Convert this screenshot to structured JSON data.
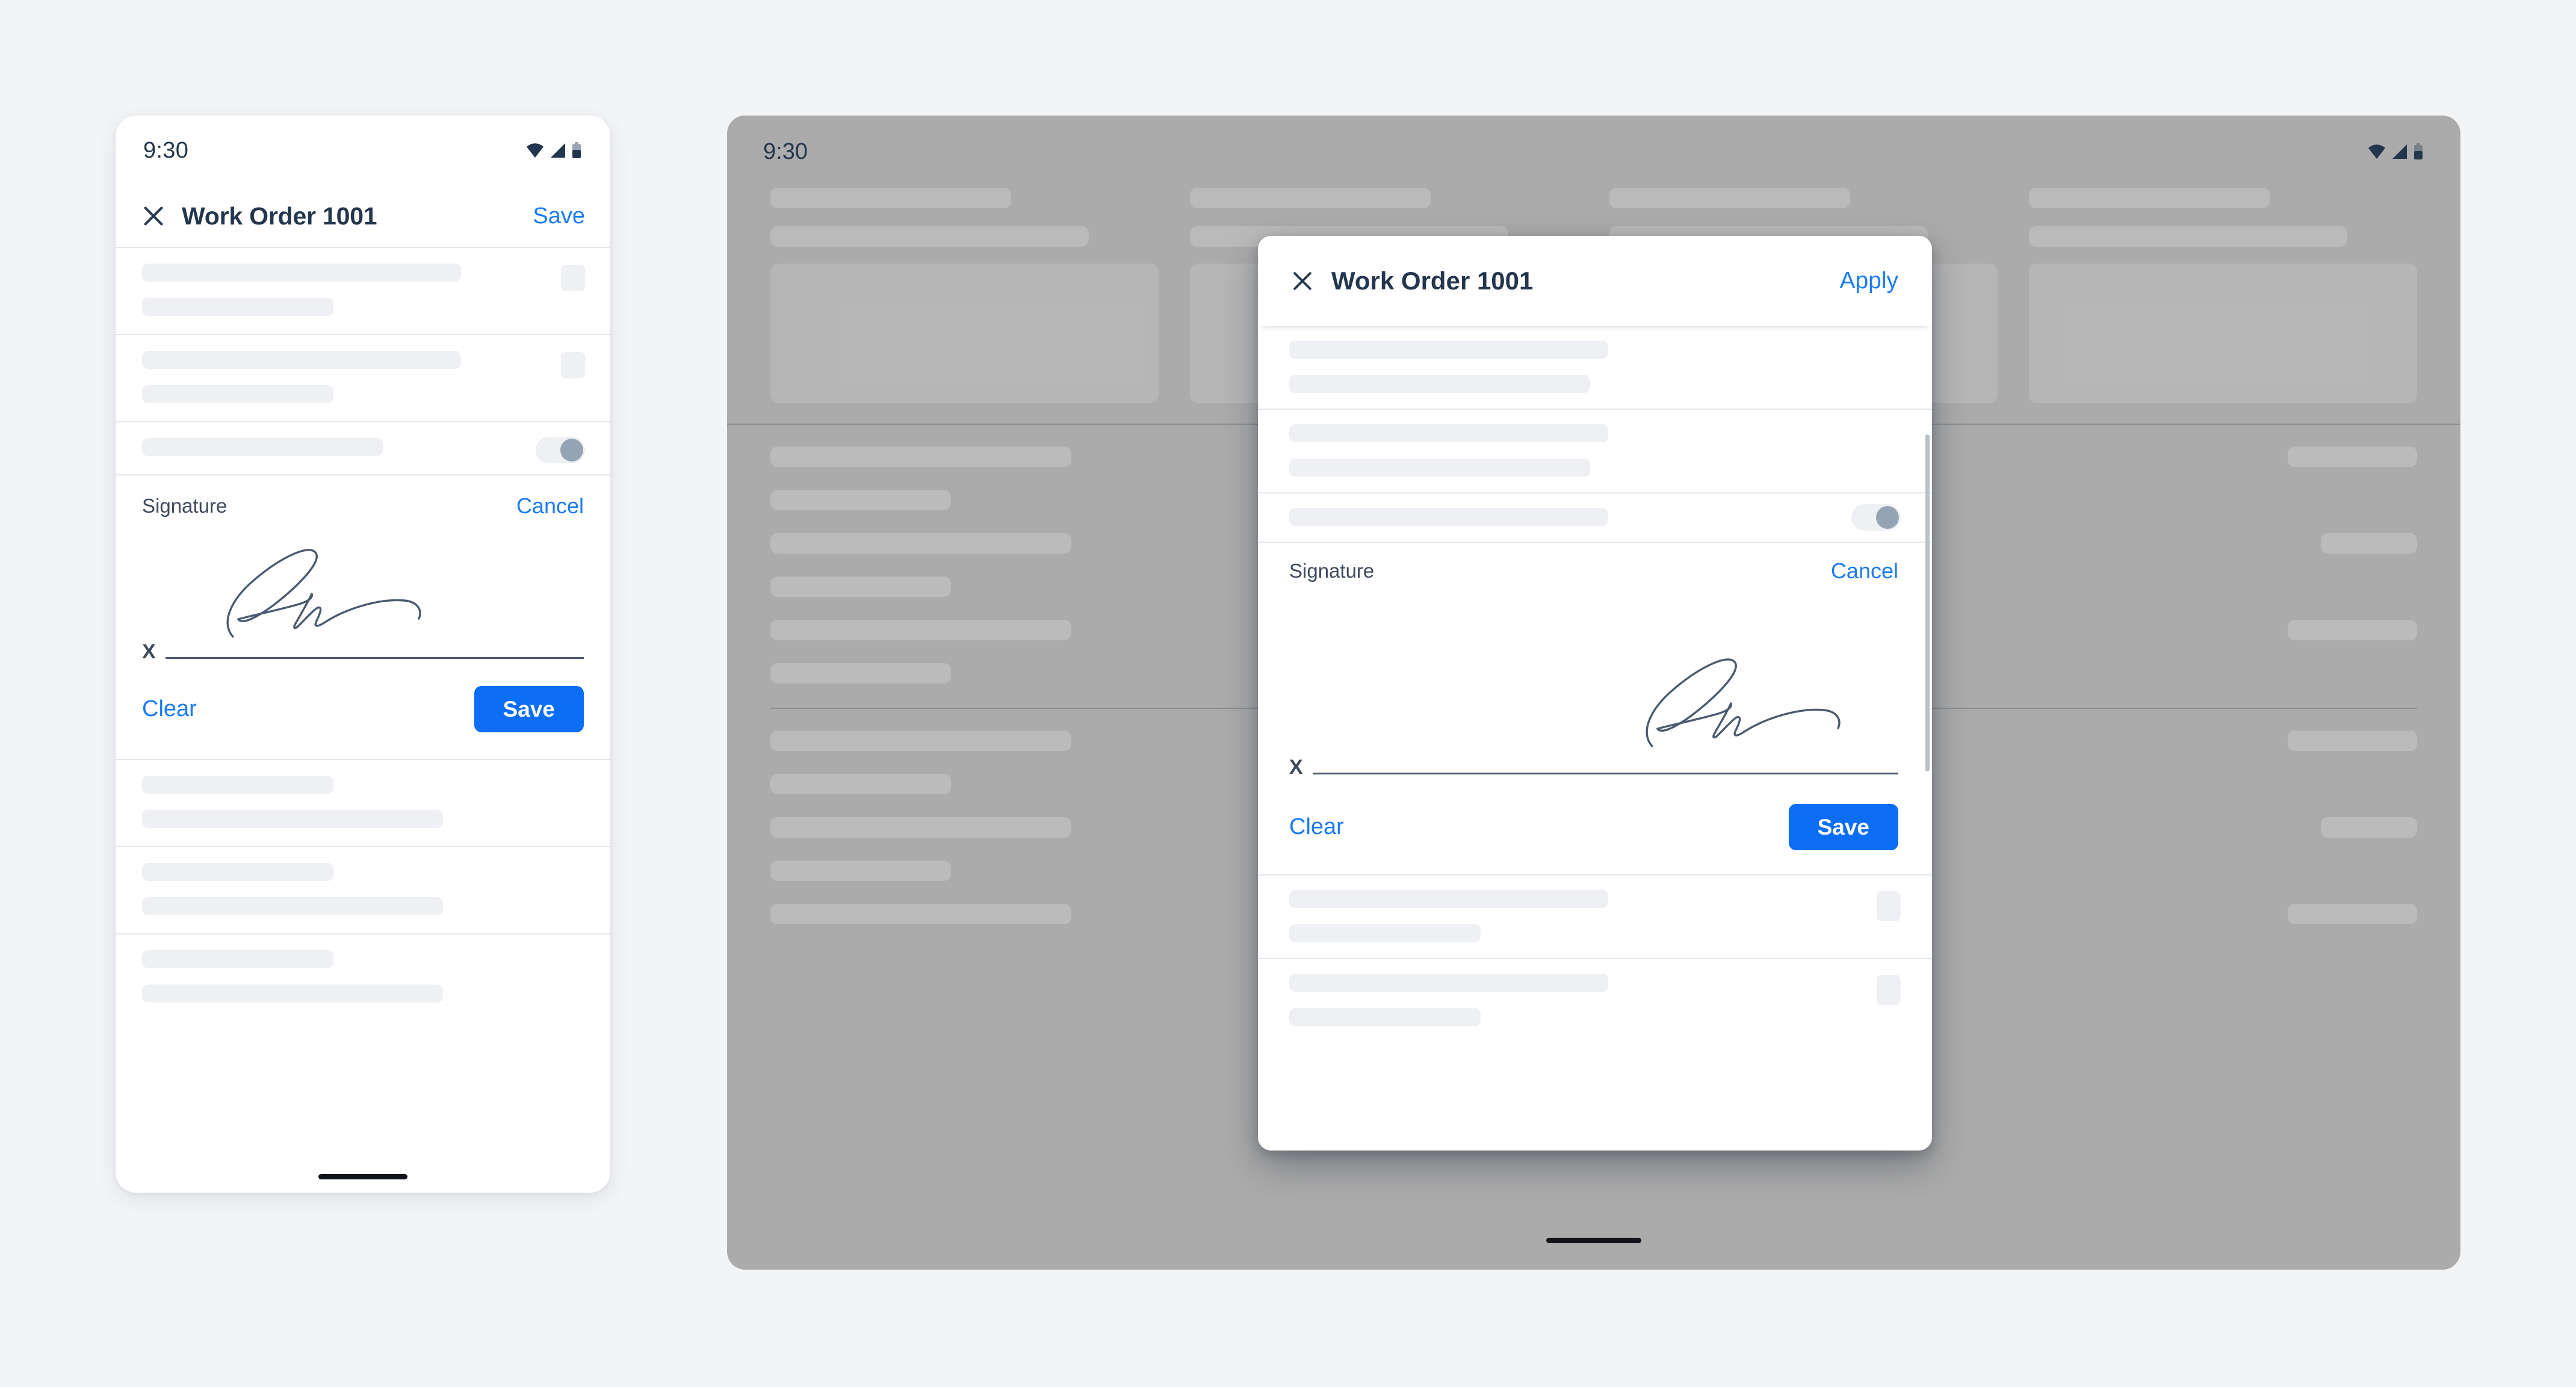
{
  "phone": {
    "status_bar": {
      "time": "9:30",
      "icons": [
        "wifi-icon",
        "cellular-signal-icon",
        "battery-icon"
      ]
    },
    "app_bar": {
      "close": "✕",
      "title": "Work Order 1001",
      "action": "Save"
    },
    "signature": {
      "label": "Signature",
      "cancel": "Cancel",
      "baseline_mark": "X",
      "clear": "Clear",
      "save": "Save"
    }
  },
  "tablet": {
    "status_bar": {
      "time": "9:30",
      "icons": [
        "wifi-icon",
        "cellular-signal-icon",
        "battery-icon"
      ]
    }
  },
  "dialog": {
    "app_bar": {
      "close": "✕",
      "title": "Work Order 1001",
      "action": "Apply"
    },
    "signature": {
      "label": "Signature",
      "cancel": "Cancel",
      "baseline_mark": "X",
      "clear": "Clear",
      "save": "Save"
    }
  },
  "colors": {
    "page_background": "#f3f4f6",
    "accent_blue": "#0b6ef5",
    "link_blue": "#1b7cf5",
    "text_dark": "#23364d",
    "skeleton": "#eef0f4",
    "scrim_gray": "#ababab",
    "signature_ink": "#4a5a70"
  }
}
